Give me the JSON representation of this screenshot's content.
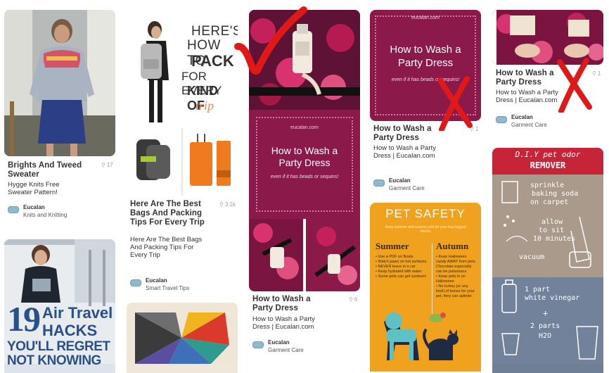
{
  "pins": [
    {
      "id": "sweater",
      "title": "Brights And Tweed Sweater",
      "description": "Hygge Knits Free Sweater Pattern!",
      "repin_count": "17",
      "user": "Eucalan",
      "board": "Knits and Knitting"
    },
    {
      "id": "travel-19",
      "image_text": {
        "number": "19",
        "line1": "Air Travel",
        "line2": "HACKS",
        "line3": "YOU'LL REGRET",
        "line4": "NOT KNOWING"
      }
    },
    {
      "id": "bags",
      "image_text": {
        "l1": "HERE'S",
        "l2": "HOW TO",
        "l3": "PACK",
        "l4": "FOR EVERY",
        "l5": "KIND OF",
        "l6": "trip"
      },
      "title": "Here Are The Best Bags And Packing Tips For Every Trip",
      "description": "Here Are The Best Bags And Packing Tips For Every Trip",
      "repin_count": "3.1k",
      "user": "Eucalan",
      "board": "Smart Travel Tips"
    },
    {
      "id": "quilt"
    },
    {
      "id": "dress-tall",
      "image_text": {
        "brand": "eucalan.com",
        "l1": "How to Wash a",
        "l2": "Party Dress",
        "sub": "even if it has beads or sequins!"
      },
      "title": "How to Wash a Party Dress",
      "description": "How to Wash a Party Dress | Eucalan.com",
      "repin_count": "6",
      "user": "Eucalan",
      "board": "Garment Care"
    },
    {
      "id": "dress-card",
      "image_text": {
        "brand": "eucalan.com",
        "l1": "How to Wash a",
        "l2": "Party Dress",
        "sub": "even if it has beads or sequins!"
      },
      "title": "How to Wash a Party Dress",
      "description": "How to Wash a Party Dress | Eucalan.com",
      "repin_count": "1",
      "user": "Eucalan",
      "board": "Garment Care"
    },
    {
      "id": "pet-safety",
      "image_text": {
        "heading": "PET SAFETY",
        "intro": "Keep summer and autumn safe for your four-legged friends",
        "summer_label": "Summer",
        "autumn_label": "Autumn",
        "summer_items": [
          "Use a PDF on Boats",
          "Watch paws on hot surfaces",
          "NEVER leave in a car",
          "Keep hydrated with water",
          "Some pets can get sunburn!"
        ],
        "autumn_items": [
          "Keep Halloween candy AWAY from pets. Chocolate especially can be poisonous.",
          "Keep pets in on Halloween",
          "No turkey (or any kind) of bones for your pet, they can splinter."
        ]
      }
    },
    {
      "id": "dress-small",
      "title": "How to Wash a Party Dress",
      "description": "How to Wash a Party Dress | Eucalan.com",
      "repin_count": "1",
      "user": "Eucalan",
      "board": "Garment Care"
    },
    {
      "id": "pet-odor",
      "image_text": {
        "heading1": "D.I.Y pet odor",
        "heading2": "REMOVER",
        "step1a": "sprinkle",
        "step1b": "baking soda",
        "step1c": "on carpet",
        "step2a": "allow",
        "step2b": "to sit",
        "step2c": "10 minutes",
        "step3": "vacuum",
        "part1": "1 part",
        "part1b": "white vinegar",
        "plus": "+",
        "part2": "2 parts",
        "part2b": "H2O"
      }
    }
  ],
  "colors": {
    "magenta": "#8b1a4a",
    "pet_orange": "#f0a21e",
    "odor_red": "#c7243a",
    "red_mark": "#e01818"
  },
  "icons": [
    "checkmark-icon",
    "x-mark-icon",
    "pin-icon",
    "board-logo-icon"
  ]
}
